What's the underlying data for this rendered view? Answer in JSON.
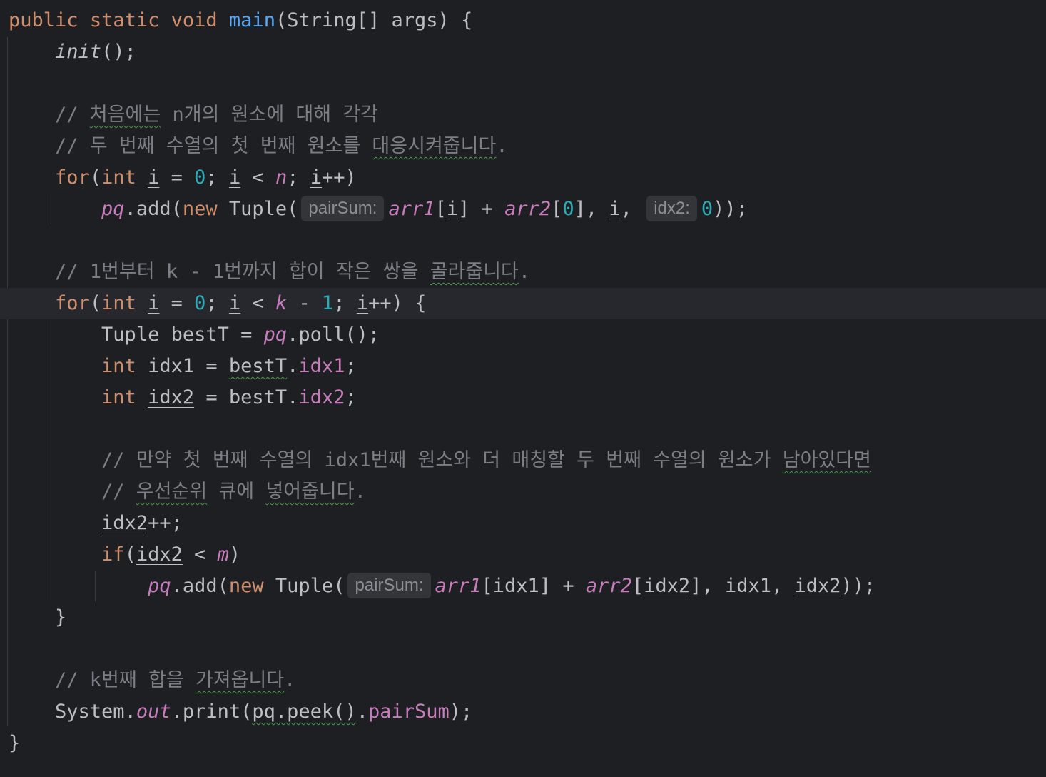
{
  "code": {
    "line1": {
      "kw1": "public",
      "kw2": "static",
      "kw3": "void",
      "method": "main",
      "paren": "(String[] args) {"
    },
    "line2": {
      "call": "init",
      "rest": "();"
    },
    "line4": {
      "prefix": "// ",
      "typo": "처음에는",
      "rest": " n개의 원소에 대해 각각"
    },
    "line5": {
      "prefix": "// 두 번째 수열의 첫 번째 원소를 ",
      "typo": "대응시켜줍니다",
      "rest": "."
    },
    "line6": {
      "kw": "for",
      "p1": "(",
      "int": "int",
      "sp": " ",
      "i1": "i",
      "eq": " = ",
      "zero": "0",
      "semi1": "; ",
      "i2": "i",
      "lt": " < ",
      "n": "n",
      "semi2": "; ",
      "i3": "i",
      "inc": "++)"
    },
    "line7": {
      "pq": "pq",
      "add": ".add(",
      "new": "new",
      "tuple": " Tuple(",
      "hint1": "pairSum:",
      "arr1": "arr1",
      "b1": "[",
      "i": "i",
      "b2": "] + ",
      "arr2": "arr2",
      "b3": "[",
      "zero": "0",
      "b4": "], ",
      "i2": "i",
      "comma": ", ",
      "hint2": "idx2:",
      "zero2": "0",
      "end": "));"
    },
    "line9": {
      "prefix": "// 1번부터 k - 1번까지 합이 작은 쌍을 ",
      "typo": "골라줍니다",
      "rest": "."
    },
    "line10": {
      "kw": "for",
      "p1": "(",
      "int": "int",
      "sp": " ",
      "i1": "i",
      "eq": " = ",
      "zero": "0",
      "semi1": "; ",
      "i2": "i",
      "lt": " < ",
      "k": "k",
      "minus": " - ",
      "one": "1",
      "semi2": "; ",
      "i3": "i",
      "inc": "++) {"
    },
    "line11": {
      "text": "Tuple bestT = ",
      "pq": "pq",
      "rest": ".poll();"
    },
    "line12": {
      "int": "int",
      "sp": " idx1 = ",
      "typo": "bestT",
      "dot": ".",
      "field": "idx1",
      "semi": ";"
    },
    "line13": {
      "int": "int",
      "sp": " ",
      "var": "idx2",
      "eq": " = bestT.",
      "field": "idx2",
      "semi": ";"
    },
    "line15": {
      "prefix": "// 만약 첫 번째 수열의 idx1번째 원소와 더 매칭할 두 번째 수열의 원소가 ",
      "typo": "남아있다면"
    },
    "line16": {
      "prefix": "// ",
      "typo1": "우선순위",
      "mid": " 큐에 ",
      "typo2": "넣어줍니다",
      "rest": "."
    },
    "line17": {
      "var": "idx2",
      "rest": "++;"
    },
    "line18": {
      "kw": "if",
      "p1": "(",
      "var": "idx2",
      "lt": " < ",
      "m": "m",
      "p2": ")"
    },
    "line19": {
      "pq": "pq",
      "add": ".add(",
      "new": "new",
      "tuple": " Tuple(",
      "hint": "pairSum:",
      "arr1": "arr1",
      "b1": "[idx1] + ",
      "arr2": "arr2",
      "b2": "[",
      "var": "idx2",
      "b3": "], idx1, ",
      "var2": "idx2",
      "end": "));"
    },
    "line20": {
      "brace": "}"
    },
    "line22": {
      "prefix": "// k번째 합을 ",
      "typo": "가져옵니다",
      "rest": "."
    },
    "line23": {
      "sys": "System.",
      "out": "out",
      "print": ".print(",
      "typo": "pq.peek()",
      "dot": ".",
      "field": "pairSum",
      "end": ");"
    },
    "line24": {
      "brace": "}"
    }
  },
  "colors": {
    "background": "#1e1f22",
    "current_line": "#26282e",
    "keyword": "#cf8e6d",
    "method_decl": "#56a8f5",
    "number": "#2aacb8",
    "field": "#c77dbb",
    "comment": "#7a7e85",
    "default_text": "#bcbec4",
    "inlay_hint_bg": "#343538",
    "typo_underline": "#4e9a4f"
  }
}
